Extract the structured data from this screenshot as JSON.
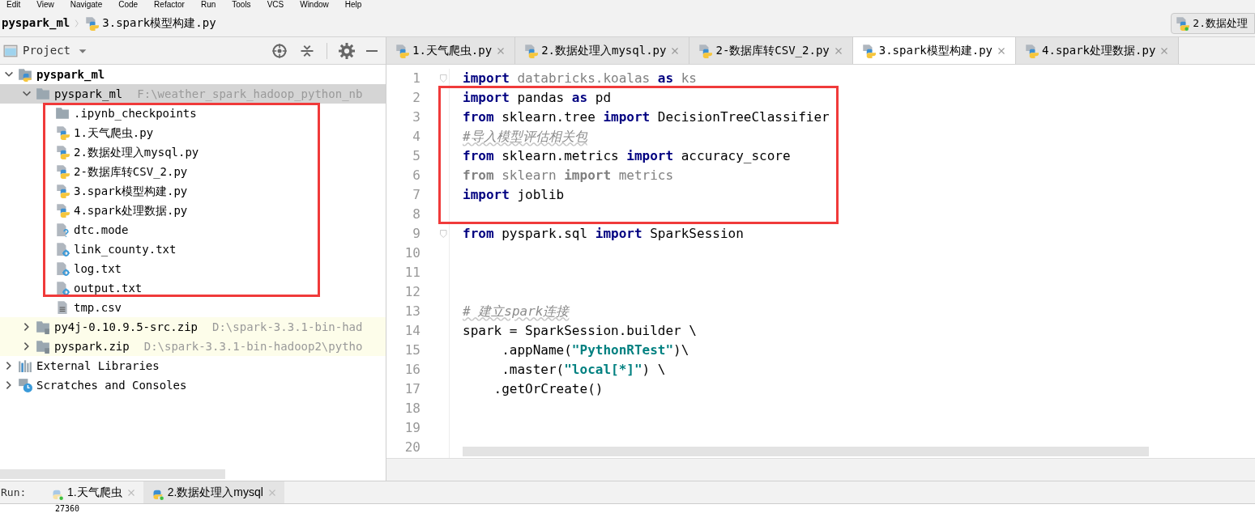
{
  "menu": [
    "Edit",
    "View",
    "Navigate",
    "Code",
    "Refactor",
    "Run",
    "Tools",
    "VCS",
    "Window",
    "Help"
  ],
  "breadcrumbs": [
    {
      "label": "pyspark_ml",
      "kind": "project"
    },
    {
      "label": "3.spark模型构建.py",
      "kind": "python"
    }
  ],
  "run_config": {
    "label": "2.数据处理"
  },
  "project_panel": {
    "title": "Project",
    "tree": [
      {
        "label": "pyspark_ml",
        "kind": "project",
        "expanded": true,
        "selected": false,
        "children": [
          {
            "label": "pyspark_ml",
            "path": "F:\\weather_spark_hadoop_python_nb",
            "kind": "folder",
            "expanded": true,
            "selected": true,
            "children": [
              {
                "label": ".ipynb_checkpoints",
                "kind": "folder",
                "selected": false
              },
              {
                "label": "1.天气爬虫.py",
                "kind": "python",
                "selected": false
              },
              {
                "label": "2.数据处理入mysql.py",
                "kind": "python",
                "selected": false
              },
              {
                "label": "2-数据库转CSV_2.py",
                "kind": "python",
                "selected": false
              },
              {
                "label": "3.spark模型构建.py",
                "kind": "python",
                "selected": false
              },
              {
                "label": "4.spark处理数据.py",
                "kind": "python",
                "selected": false
              },
              {
                "label": "dtc.mode",
                "kind": "unknown",
                "selected": false
              },
              {
                "label": "link_county.txt",
                "kind": "text",
                "selected": false
              },
              {
                "label": "log.txt",
                "kind": "text",
                "selected": false
              },
              {
                "label": "output.txt",
                "kind": "text",
                "selected": false
              },
              {
                "label": "tmp.csv",
                "kind": "csv",
                "selected": false
              }
            ]
          },
          {
            "label": "py4j-0.10.9.5-src.zip",
            "path": "D:\\spark-3.3.1-bin-had",
            "kind": "zip",
            "expanded": false,
            "selected": false
          },
          {
            "label": "pyspark.zip",
            "path": "D:\\spark-3.3.1-bin-hadoop2\\pytho",
            "kind": "zip",
            "expanded": false,
            "selected": false
          }
        ]
      },
      {
        "label": "External Libraries",
        "kind": "libraries",
        "expanded": false,
        "selected": false
      },
      {
        "label": "Scratches and Consoles",
        "kind": "scratches",
        "expanded": false,
        "selected": false
      }
    ]
  },
  "editor_tabs": [
    {
      "label": "1.天气爬虫.py",
      "selected": false
    },
    {
      "label": "2.数据处理入mysql.py",
      "selected": false
    },
    {
      "label": "2-数据库转CSV_2.py",
      "selected": false
    },
    {
      "label": "3.spark模型构建.py",
      "selected": true
    },
    {
      "label": "4.spark处理数据.py",
      "selected": false
    }
  ],
  "code_lines": [
    {
      "number": "1",
      "fold": true,
      "tokens": [
        {
          "kind": "keyword",
          "text": "import"
        },
        {
          "kind": "unused",
          "text": " databricks.koalas "
        },
        {
          "kind": "keyword",
          "text": "as"
        },
        {
          "kind": "unused",
          "text": " ks"
        }
      ]
    },
    {
      "number": "2",
      "fold": false,
      "tokens": [
        {
          "kind": "keyword",
          "text": "import"
        },
        {
          "kind": "name",
          "text": " pandas "
        },
        {
          "kind": "keyword",
          "text": "as"
        },
        {
          "kind": "name",
          "text": " pd"
        }
      ]
    },
    {
      "number": "3",
      "fold": false,
      "tokens": [
        {
          "kind": "keyword",
          "text": "from"
        },
        {
          "kind": "name",
          "text": " sklearn.tree "
        },
        {
          "kind": "keyword",
          "text": "import"
        },
        {
          "kind": "name",
          "text": " DecisionTreeClassifier"
        }
      ]
    },
    {
      "number": "4",
      "fold": false,
      "tokens": [
        {
          "kind": "comment",
          "text": "#导入模型评估相关包"
        }
      ]
    },
    {
      "number": "5",
      "fold": false,
      "tokens": [
        {
          "kind": "keyword",
          "text": "from"
        },
        {
          "kind": "name",
          "text": " sklearn.metrics "
        },
        {
          "kind": "keyword",
          "text": "import"
        },
        {
          "kind": "name",
          "text": " accuracy_score"
        }
      ]
    },
    {
      "number": "6",
      "fold": false,
      "tokens": [
        {
          "kind": "unused_keyword",
          "text": "from"
        },
        {
          "kind": "unused",
          "text": " sklearn "
        },
        {
          "kind": "unused_keyword",
          "text": "import"
        },
        {
          "kind": "unused",
          "text": " metrics"
        }
      ]
    },
    {
      "number": "7",
      "fold": false,
      "tokens": [
        {
          "kind": "keyword",
          "text": "import"
        },
        {
          "kind": "name",
          "text": " joblib"
        }
      ]
    },
    {
      "number": "8",
      "fold": false
    },
    {
      "number": "9",
      "fold": true,
      "tokens": [
        {
          "kind": "keyword",
          "text": "from"
        },
        {
          "kind": "name",
          "text": " pyspark.sql "
        },
        {
          "kind": "keyword",
          "text": "import"
        },
        {
          "kind": "name",
          "text": " SparkSession"
        }
      ]
    },
    {
      "number": "10",
      "fold": false
    },
    {
      "number": "11",
      "fold": false
    },
    {
      "number": "12",
      "fold": false
    },
    {
      "number": "13",
      "fold": false,
      "tokens": [
        {
          "kind": "comment",
          "text": "# 建立spark连接"
        }
      ]
    },
    {
      "number": "14",
      "fold": false,
      "tokens": [
        {
          "kind": "name",
          "text": "spark = SparkSession.builder \\"
        }
      ]
    },
    {
      "number": "15",
      "fold": false,
      "tokens": [
        {
          "kind": "name",
          "text": "     .appName("
        },
        {
          "kind": "string",
          "text": "\"PythonRTest\""
        },
        {
          "kind": "name",
          "text": ")\\"
        }
      ]
    },
    {
      "number": "16",
      "fold": false,
      "tokens": [
        {
          "kind": "name",
          "text": "     .master("
        },
        {
          "kind": "string",
          "text": "\"local[*]\""
        },
        {
          "kind": "name",
          "text": ") \\"
        }
      ]
    },
    {
      "number": "17",
      "fold": false,
      "tokens": [
        {
          "kind": "name",
          "text": "    .getOrCreate()"
        }
      ]
    },
    {
      "number": "18",
      "fold": false
    },
    {
      "number": "19",
      "fold": false
    },
    {
      "number": "20",
      "fold": false
    }
  ],
  "run_bar": {
    "label": "Run:",
    "tabs": [
      {
        "label": "1.天气爬虫",
        "selected": false
      },
      {
        "label": "2.数据处理入mysql",
        "selected": true
      }
    ]
  },
  "console": {
    "text": "27360"
  },
  "highlight_boxes": [
    {
      "kind": "rectangle"
    },
    {
      "kind": "rectangle"
    }
  ]
}
